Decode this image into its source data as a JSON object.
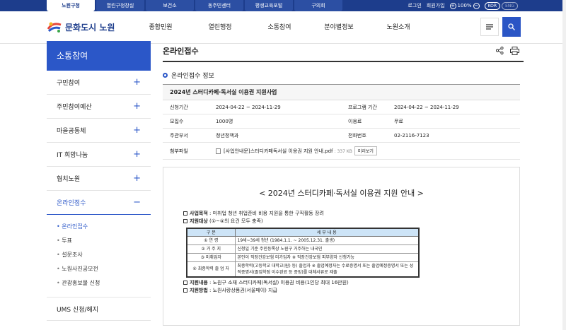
{
  "topbar": {
    "tabs": [
      "노원구청",
      "열린구청장실",
      "보건소",
      "동주민센터",
      "평생교육포털",
      "구의회"
    ],
    "login": "로그인",
    "join": "회원가입",
    "zoom": "100%",
    "lang_kor": "KOR",
    "lang_eng": "ENG"
  },
  "header": {
    "logo": "문화도시 노원",
    "gnb": [
      "종합민원",
      "열린행정",
      "소통참여",
      "분야별정보",
      "노원소개"
    ]
  },
  "lnb": {
    "title": "소통참여",
    "items": [
      "구민참여",
      "주민참여예산",
      "마을공동체",
      "IT 희망나눔",
      "협치노원",
      "온라인접수"
    ],
    "sub": [
      "온라인접수",
      "투표",
      "설문조사",
      "노원사진공모전",
      "관광홍보물 신청"
    ],
    "last": "UMS 신청/해지"
  },
  "content": {
    "page_title": "온라인접수",
    "section_title": "온라인접수 정보",
    "info_title": "2024년 스터디카페·독서실 이용권 지원사업",
    "rows": [
      {
        "l1": "신청기간",
        "v1": "2024-04-22 ~ 2024-11-29",
        "l2": "프로그램 기간",
        "v2": "2024-04-22 ~ 2024-11-29"
      },
      {
        "l1": "모집수",
        "v1": "1000명",
        "l2": "이용료",
        "v2": "무료"
      },
      {
        "l1": "주관부서",
        "v1": "청년정책과",
        "l2": "전화번호",
        "v2": "02-2116-7123"
      }
    ],
    "file_label": "첨부파일",
    "file_name": "[사업안내문]스터디카페독서실 이용권 지원 안내.pdf",
    "file_size": ": 337 KB",
    "preview": "미리보기"
  },
  "poster": {
    "title": "< 2024년 스터디카페·독서실 이용권 지원 안내 >",
    "purpose_label": "사업목적",
    "purpose": " : 미취업 청년 취업준비 비용 지원을 통한 구직활동 장려",
    "target_label": "지원대상",
    "target": " (①~④의 요건 모두 충족)",
    "th1": "구 분",
    "th2": "세 부 내 용",
    "rows": [
      {
        "k": "① 연 령",
        "v": "19세~39세 청년 (1984.1.1. ~ 2005.12.31. 출생)"
      },
      {
        "k": "② 거 주 지",
        "v": "신청일 기준 주민등록상 노원구 거주하는 내국인"
      },
      {
        "k": "③ 미취업자",
        "v": "본인이 직장건강보험 미가입자 ※ 직장건강보험 피부양자 신청가능"
      },
      {
        "k": "④ 최종학력 졸 업 자",
        "v": "최종학력(고등학교 대학교(원) 등) 졸업자 ※ 졸업예정자는 수료증명서 또는 졸업예정증명서 또는 성적증명서(졸업학점 이수완료 등 증빙)를 대체서류로 제출"
      }
    ],
    "content_label": "지원내용",
    "content": " : 노원구 소재 스터디카페(독서실) 이용권 비용(1인당 최대 16만원)",
    "method_label": "지원방법",
    "method": " : 노원사랑상품권(서울페이) 지급"
  }
}
